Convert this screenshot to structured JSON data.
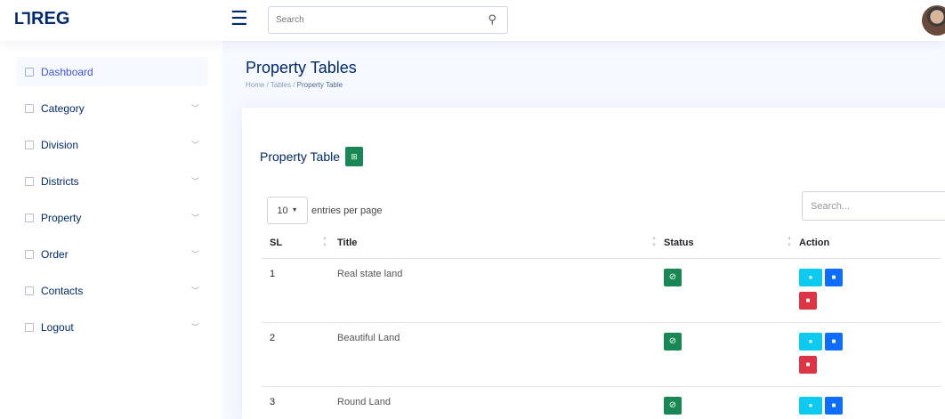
{
  "app": {
    "logo_mark": "L᠊",
    "logo_text": "REG"
  },
  "header": {
    "search_placeholder": "Search"
  },
  "sidebar": {
    "items": [
      {
        "label": "Dashboard",
        "active": true,
        "chevron": false
      },
      {
        "label": "Category",
        "chevron": true
      },
      {
        "label": "Division",
        "chevron": true
      },
      {
        "label": "Districts",
        "chevron": true
      },
      {
        "label": "Property",
        "chevron": true
      },
      {
        "label": "Order",
        "chevron": true
      },
      {
        "label": "Contacts",
        "chevron": true
      },
      {
        "label": "Logout",
        "chevron": true
      }
    ]
  },
  "page": {
    "title": "Property Tables",
    "breadcrumb": {
      "home": "Home",
      "sep1": " / ",
      "tables": "Tables",
      "sep2": " / ",
      "current": "Property Table"
    }
  },
  "card": {
    "title": "Property Table",
    "entries_value": "10",
    "entries_label": "entries per page",
    "search_placeholder": "Search..."
  },
  "table": {
    "columns": {
      "sl": "SL",
      "title": "Title",
      "status": "Status",
      "action": "Action"
    },
    "rows": [
      {
        "sl": "1",
        "title": "Real state land"
      },
      {
        "sl": "2",
        "title": "Beautiful Land"
      },
      {
        "sl": "3",
        "title": "Round Land"
      }
    ]
  },
  "colors": {
    "brand": "#012970",
    "success": "#198754",
    "info": "#0dcaf0",
    "primary": "#0d6efd",
    "danger": "#dc3545"
  }
}
